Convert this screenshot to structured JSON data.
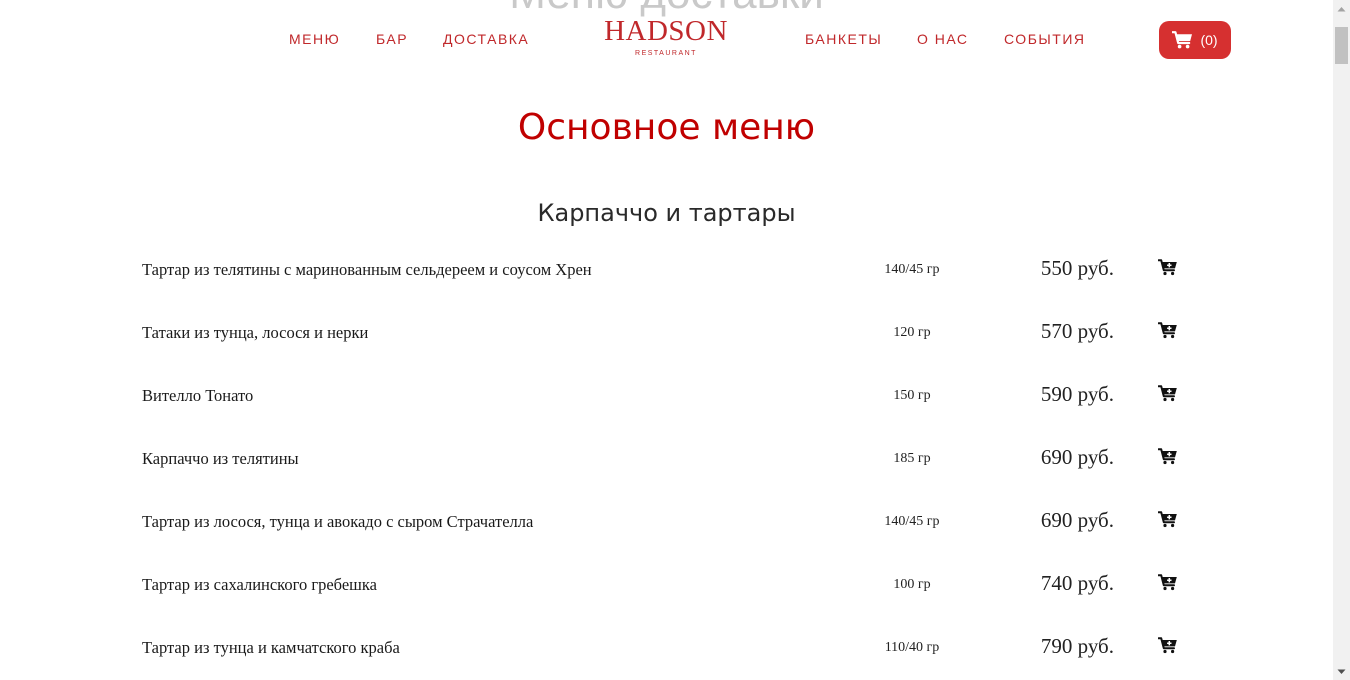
{
  "ghost_heading": "Меню доставки",
  "header": {
    "nav_left": [
      "МЕНЮ",
      "БАР",
      "ДОСТАВКА"
    ],
    "nav_right": [
      "БАНКЕТЫ",
      "О НАС",
      "СОБЫТИЯ"
    ],
    "logo_main": "HADSON",
    "logo_sub": "RESTAURANT",
    "cart_count": "(0)",
    "cart_icon": "shopping-cart-icon"
  },
  "page_title": "Основное меню",
  "section_title": "Карпаччо и тартары",
  "menu_items": [
    {
      "name": "Тартар из телятины с маринованным сельдереем и соусом Хрен",
      "weight": "140/45 гр",
      "price": "550 руб."
    },
    {
      "name": "Татаки из тунца, лосося и нерки",
      "weight": "120 гр",
      "price": "570 руб."
    },
    {
      "name": "Вителло Тонато",
      "weight": "150 гр",
      "price": "590 руб."
    },
    {
      "name": "Карпаччо из телятины",
      "weight": "185 гр",
      "price": "690 руб."
    },
    {
      "name": "Тартар из лосося, тунца и авокадо с сыром Страчателла",
      "weight": "140/45 гр",
      "price": "690 руб."
    },
    {
      "name": "Тартар из сахалинского гребешка",
      "weight": "100 гр",
      "price": "740 руб."
    },
    {
      "name": "Тартар из тунца и камчатского краба",
      "weight": "110/40 гр",
      "price": "790 руб."
    }
  ],
  "colors": {
    "brand_red": "#c0282b",
    "title_red": "#c00000",
    "cart_button_bg": "#d63030"
  }
}
